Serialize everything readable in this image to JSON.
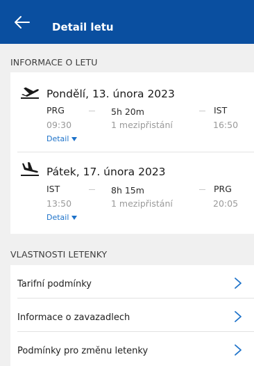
{
  "header": {
    "title": "Detail letu",
    "back_icon": "arrow-left-icon"
  },
  "flight_info": {
    "section_title": "INFORMACE O LETU",
    "flights": [
      {
        "direction_icon": "plane-takeoff-icon",
        "date": "Pondělí, 13. února 2023",
        "from_code": "PRG",
        "to_code": "IST",
        "duration": "5h 20m",
        "departure_time": "09:30",
        "arrival_time": "16:50",
        "stops": "1 mezipřistání",
        "detail_label": "Detail"
      },
      {
        "direction_icon": "plane-landing-icon",
        "date": "Pátek, 17. února 2023",
        "from_code": "IST",
        "to_code": "PRG",
        "duration": "8h 15m",
        "departure_time": "13:50",
        "arrival_time": "20:05",
        "stops": "1 mezipřistání",
        "detail_label": "Detail"
      }
    ]
  },
  "ticket_properties": {
    "section_title": "VLASTNOSTI LETENKY",
    "items": [
      {
        "label": "Tarifní podmínky"
      },
      {
        "label": "Informace o zavazadlech"
      },
      {
        "label": "Podmínky pro změnu letenky"
      }
    ]
  },
  "colors": {
    "header_bg": "#0a4fa0",
    "accent_link": "#1d72c9",
    "page_bg": "#f0f0f0"
  }
}
